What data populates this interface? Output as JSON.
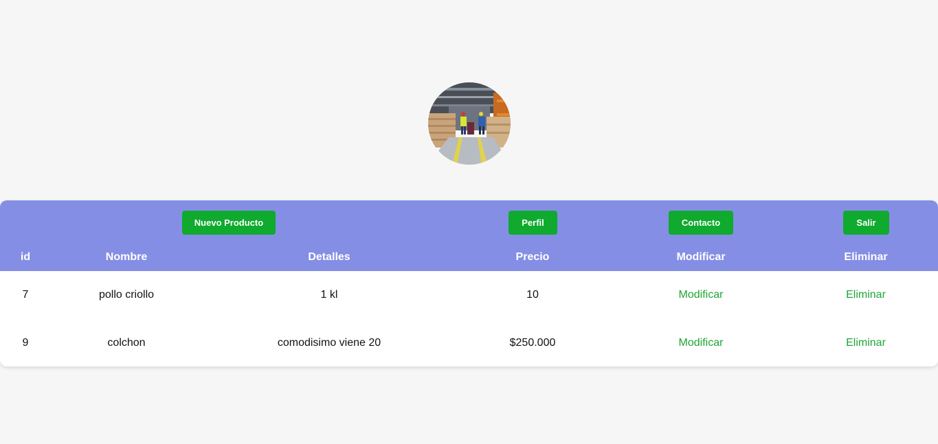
{
  "profile": {
    "avatar_image": "warehouse-photo"
  },
  "toolbar": {
    "nuevo_producto": "Nuevo Producto",
    "perfil": "Perfil",
    "contacto": "Contacto",
    "salir": "Salir"
  },
  "table": {
    "headers": {
      "id": "id",
      "nombre": "Nombre",
      "detalles": "Detalles",
      "precio": "Precio",
      "modificar": "Modificar",
      "eliminar": "Eliminar"
    },
    "rows": [
      {
        "id": "7",
        "nombre": "pollo criollo",
        "detalles": "1 kl",
        "precio": "10",
        "modificar": "Modificar",
        "eliminar": "Eliminar"
      },
      {
        "id": "9",
        "nombre": "colchon",
        "detalles": "comodisimo viene 20",
        "precio": "$250.000",
        "modificar": "Modificar",
        "eliminar": "Eliminar"
      }
    ]
  },
  "colors": {
    "page_background": "#f6f6f6",
    "header_band": "#848ee5",
    "button": "#0faa2e",
    "link": "#1ea533"
  }
}
